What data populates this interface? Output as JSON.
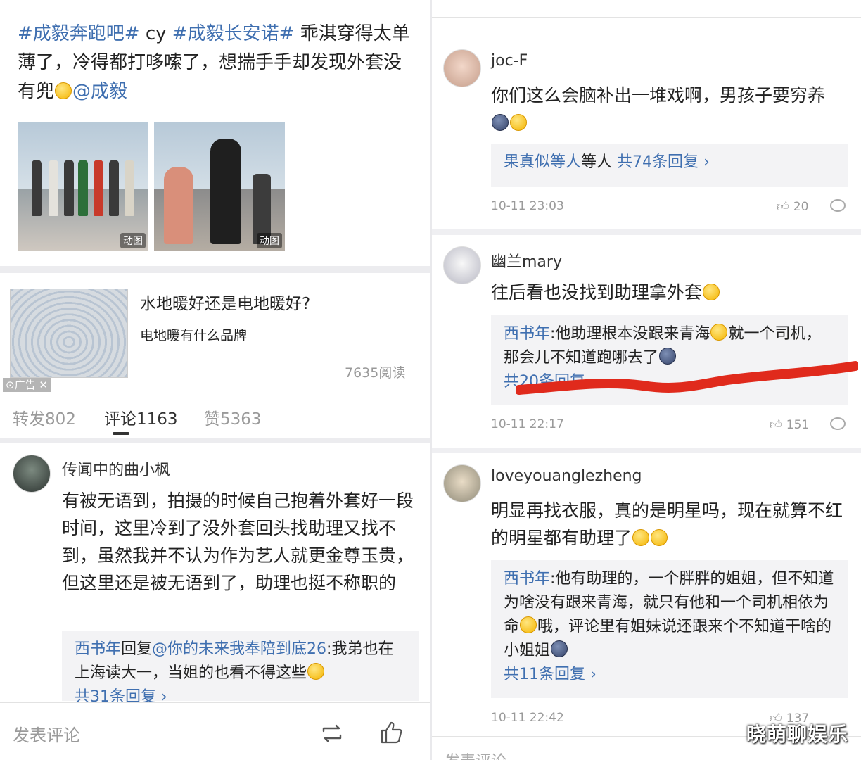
{
  "left": {
    "post": {
      "tag1": "#成毅奔跑吧#",
      "mid1": " cy ",
      "tag2": "#成毅长安诺#",
      "text": " 乖淇穿得太单薄了，冷得都打哆嗦了，想揣手手却发现外套没有兜",
      "mention": "@成毅",
      "images": [
        {
          "badge": "动图"
        },
        {
          "badge": "动图"
        }
      ]
    },
    "ad": {
      "title": "水地暖好还是电地暖好?",
      "subtitle": "电地暖有什么品牌",
      "views": "7635阅读",
      "tag": "广告"
    },
    "tabs": [
      {
        "label": "转发802"
      },
      {
        "label": "评论1163"
      },
      {
        "label": "赞5363"
      }
    ],
    "comment": {
      "name": "传闻中的曲小枫",
      "body": "有被无语到，拍摄的时候自己抱着外套好一段时间，这里冷到了没外套回头找助理又找不到，虽然我并不认为作为艺人就更金尊玉贵，但这里还是被无语到了，助理也挺不称职的",
      "reply_user": "西书年",
      "reply_word": "回复",
      "reply_mention": "@你的未来我奉陪到底26",
      "reply_text": ":我弟也在上海读大一，当姐的也看不得这些",
      "reply_count": "共31条回复 ›"
    },
    "bottom": {
      "placeholder": "发表评论"
    }
  },
  "right": {
    "comments": [
      {
        "name": "joc-F",
        "body": "你们这么会脑补出一堆戏啊，男孩子要穷养",
        "reply_summary_user": "果真似等人",
        "reply_summary_count": " 共74条回复 ›",
        "time": "10-11 23:03",
        "likes": "20"
      },
      {
        "name": "幽兰mary",
        "body": "往后看也没找到助理拿外套",
        "reply_user": "西书年",
        "reply_text": ":他助理根本没跟来青海",
        "reply_text2": "就一个司机，那会儿不知道跑哪去了",
        "reply_count": "共20条回复",
        "time": "10-11 22:17",
        "likes": "151"
      },
      {
        "name": "loveyouanglezheng",
        "body": "明显再找衣服，真的是明星吗，现在就算不红的明星都有助理了",
        "reply_user": "西书年",
        "reply_text": ":他有助理的，一个胖胖的姐姐，但不知道为啥没有跟来青海，就只有他和一个司机相依为命",
        "reply_text2": "哦，评论里有姐妹说还跟来个不知道干啥的小姐姐",
        "reply_count": "共11条回复 ›",
        "time": "10-11 22:42",
        "likes": "137"
      }
    ],
    "bottom": {
      "placeholder": "发表评论"
    }
  },
  "watermark": "晓萌聊娱乐",
  "colors": {
    "link": "#3f6fb0",
    "annotation": "#e02a1c"
  }
}
